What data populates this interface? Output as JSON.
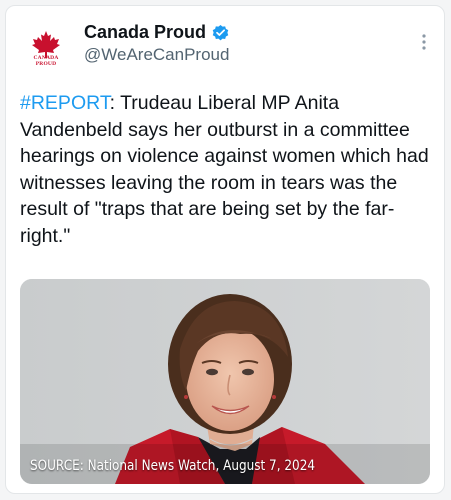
{
  "colors": {
    "hashtag": "#1d9bf0",
    "verified": "#1d9bf0",
    "brand_red": "#c8102e"
  },
  "author": {
    "avatar_text": "CANADA PROUD",
    "display_name": "Canada Proud",
    "handle": "@WeAreCanProud",
    "verified_icon": "verified-badge-icon"
  },
  "more_icon": "more-dots-vertical-icon",
  "tweet": {
    "hashtag": "#REPORT",
    "text": ": Trudeau Liberal MP Anita Vandenbeld says her outburst in a committee hearings on violence against women which had witnesses leaving the room in tears was the result of \"traps that are being set by the far-right.\""
  },
  "media": {
    "caption": "SOURCE: National News Watch, August 7, 2024"
  }
}
